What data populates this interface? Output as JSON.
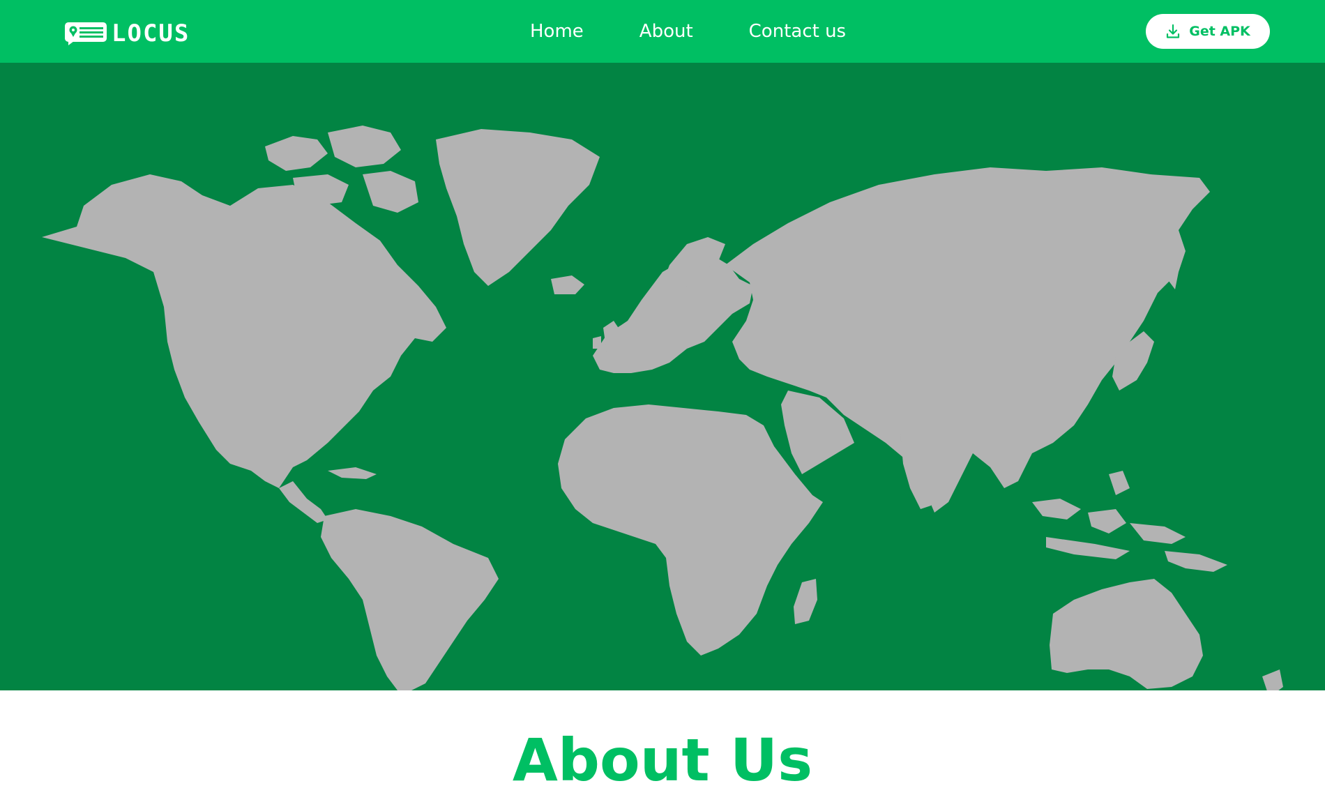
{
  "brand": {
    "name": "LOCUS",
    "logo_icon": "location-card-icon"
  },
  "nav": {
    "items": [
      {
        "label": "Home"
      },
      {
        "label": "About"
      },
      {
        "label": "Contact us"
      }
    ]
  },
  "header_button": {
    "label": "Get APK",
    "icon": "download-icon"
  },
  "hero": {
    "image": "world-map"
  },
  "section": {
    "heading": "About Us"
  },
  "colors": {
    "brand_green": "#00bf63",
    "map_background": "#028443",
    "land": "#b3b3b3",
    "white": "#ffffff"
  }
}
